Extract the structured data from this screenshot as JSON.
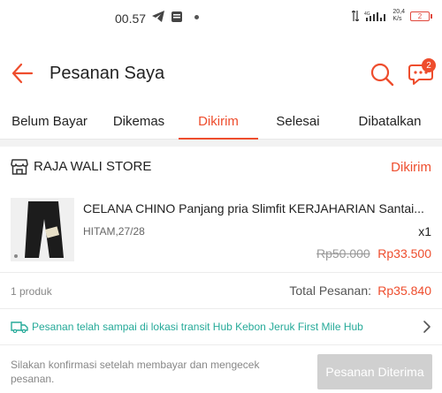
{
  "statusbar": {
    "time": "00.57",
    "net_top": "4G",
    "speed_value": "20,4",
    "speed_unit": "K/s",
    "battery": "2"
  },
  "header": {
    "title": "Pesanan Saya",
    "chat_badge": "2"
  },
  "tabs": [
    {
      "label": "Belum Bayar"
    },
    {
      "label": "Dikemas"
    },
    {
      "label": "Dikirim"
    },
    {
      "label": "Selesai"
    },
    {
      "label": "Dibatalkan"
    }
  ],
  "active_tab": "Dikirim",
  "order": {
    "store_name": "RAJA WALI STORE",
    "status": "Dikirim",
    "product": {
      "name": "CELANA CHINO Panjang pria Slimfit KERJAHARIAN Santai...",
      "variant": "HITAM,27/28",
      "quantity": "x1",
      "price_original": "Rp50.000",
      "price_discount": "Rp33.500"
    },
    "item_count": "1 produk",
    "total_label": "Total Pesanan:",
    "total_value": "Rp35.840",
    "shipping_status": "Pesanan telah sampai di lokasi transit Hub Kebon Jeruk First Mile Hub",
    "confirm_note": "Silakan konfirmasi setelah membayar dan mengecek pesanan.",
    "receive_button": "Pesanan Diterima"
  },
  "colors": {
    "accent": "#ee4d2d",
    "shipping": "#26aa99",
    "disabled_button": "#d0d0d0"
  }
}
